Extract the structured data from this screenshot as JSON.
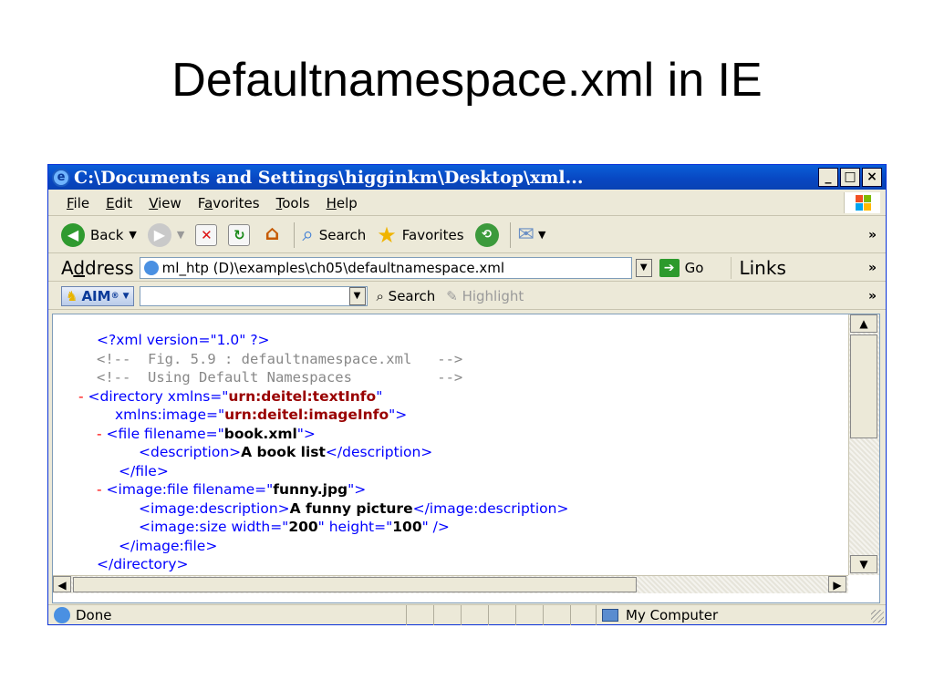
{
  "slide": {
    "title": "Defaultnamespace.xml in IE"
  },
  "window": {
    "title": "C:\\Documents and Settings\\higginkm\\Desktop\\xml...",
    "minimize": "_",
    "maximize": "□",
    "close": "×"
  },
  "menu": [
    {
      "key": "F",
      "rest": "ile"
    },
    {
      "key": "E",
      "rest": "dit"
    },
    {
      "key": "V",
      "rest": "iew"
    },
    {
      "pre": "F",
      "key": "a",
      "rest": "vorites"
    },
    {
      "key": "T",
      "rest": "ools"
    },
    {
      "key": "H",
      "rest": "elp"
    }
  ],
  "toolbar": {
    "back": "Back",
    "search": "Search",
    "favorites": "Favorites",
    "more": "»"
  },
  "address": {
    "label_pre": "A",
    "label_key": "d",
    "label_rest": "dress",
    "value": "ml_htp (D)\\examples\\ch05\\defaultnamespace.xml",
    "go": "Go",
    "links": "Links",
    "more": "»"
  },
  "aim": {
    "button": "AIM",
    "search": "Search",
    "highlight": "Highlight",
    "more": "»"
  },
  "xml": {
    "l1": "<?xml version=\"1.0\" ?>",
    "l2": "<!--  Fig. 5.9 : defaultnamespace.xml   -->",
    "l3": "<!--  Using Default Namespaces          -->",
    "l4_mk": "- ",
    "l4_a": "<directory xmlns=\"",
    "l4_v": "urn:deitel:textInfo",
    "l4_b": "\"",
    "l5_a": "xmlns:image=\"",
    "l5_v": "urn:deitel:imageInfo",
    "l5_b": "\">",
    "l6_mk": "- ",
    "l6_a": "<file filename=\"",
    "l6_v": "book.xml",
    "l6_b": "\">",
    "l7_a": "<description>",
    "l7_v": "A book list",
    "l7_b": "</description>",
    "l8": "</file>",
    "l9_mk": "- ",
    "l9_a": "<image:file filename=\"",
    "l9_v": "funny.jpg",
    "l9_b": "\">",
    "l10_a": "<image:description>",
    "l10_v": "A funny picture",
    "l10_b": "</image:description>",
    "l11_a": "<image:size width=\"",
    "l11_v1": "200",
    "l11_m": "\" height=\"",
    "l11_v2": "100",
    "l11_b": "\" />",
    "l12": "</image:file>",
    "l13": "</directory>"
  },
  "status": {
    "text": "Done",
    "zone": "My Computer"
  }
}
